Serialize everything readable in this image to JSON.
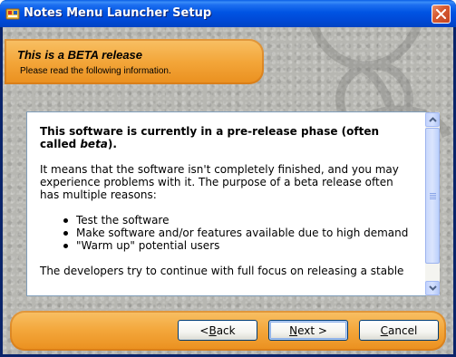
{
  "window": {
    "title": "Notes Menu Launcher Setup",
    "title_icon": "installer-icon",
    "close_icon": "close-icon"
  },
  "header": {
    "title": "This is a BETA release",
    "subtitle": "Please read the following information."
  },
  "content": {
    "intro_prefix": "This software is currently in a pre-release phase (often called ",
    "intro_italic": "beta",
    "intro_suffix": ").",
    "paragraph": "It means that the software isn't completely finished, and you may experience problems with it. The purpose of a beta release often has multiple reasons:",
    "bullets": [
      "Test the software",
      "Make software and/or features available due to high demand",
      "\"Warm up\" potential users"
    ],
    "partial_line": "The developers try to continue with full focus on releasing a stable"
  },
  "buttons": {
    "back": {
      "prefix": "< ",
      "underline": "B",
      "rest": "ack"
    },
    "next": {
      "prefix": "",
      "underline": "N",
      "rest": "ext >"
    },
    "cancel": {
      "prefix": "",
      "underline": "C",
      "rest": "ancel"
    }
  },
  "colors": {
    "titlebar": "#0054e3",
    "panel_orange": "#f3a63a",
    "content_border": "#7f9db9"
  }
}
